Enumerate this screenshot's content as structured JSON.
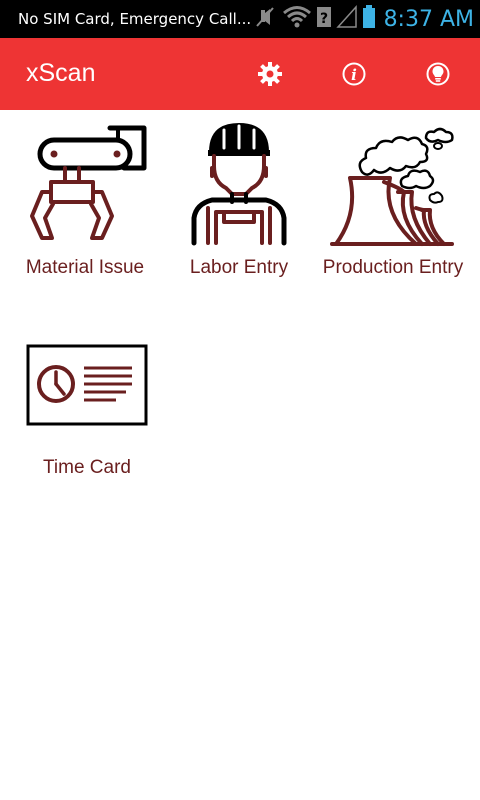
{
  "status_bar": {
    "carrier_text": "No SIM Card, Emergency Call...",
    "time": "8:37 AM",
    "icons": [
      "mute-icon",
      "wifi-icon",
      "no-signal-icon",
      "battery-icon"
    ],
    "time_color": "#3db3e6"
  },
  "app_bar": {
    "title": "xScan",
    "color": "#ee3434",
    "actions": [
      "settings-icon",
      "info-icon",
      "lightbulb-icon"
    ]
  },
  "tiles": [
    {
      "label": "Material Issue",
      "icon": "robot-arm-icon"
    },
    {
      "label": "Labor Entry",
      "icon": "worker-icon"
    },
    {
      "label": "Production Entry",
      "icon": "factory-icon"
    },
    {
      "label": "Time Card",
      "icon": "time-card-icon"
    }
  ],
  "colors": {
    "icon_primary": "#6a1f1f",
    "icon_outline": "#000000",
    "label": "#6a1f1f"
  }
}
